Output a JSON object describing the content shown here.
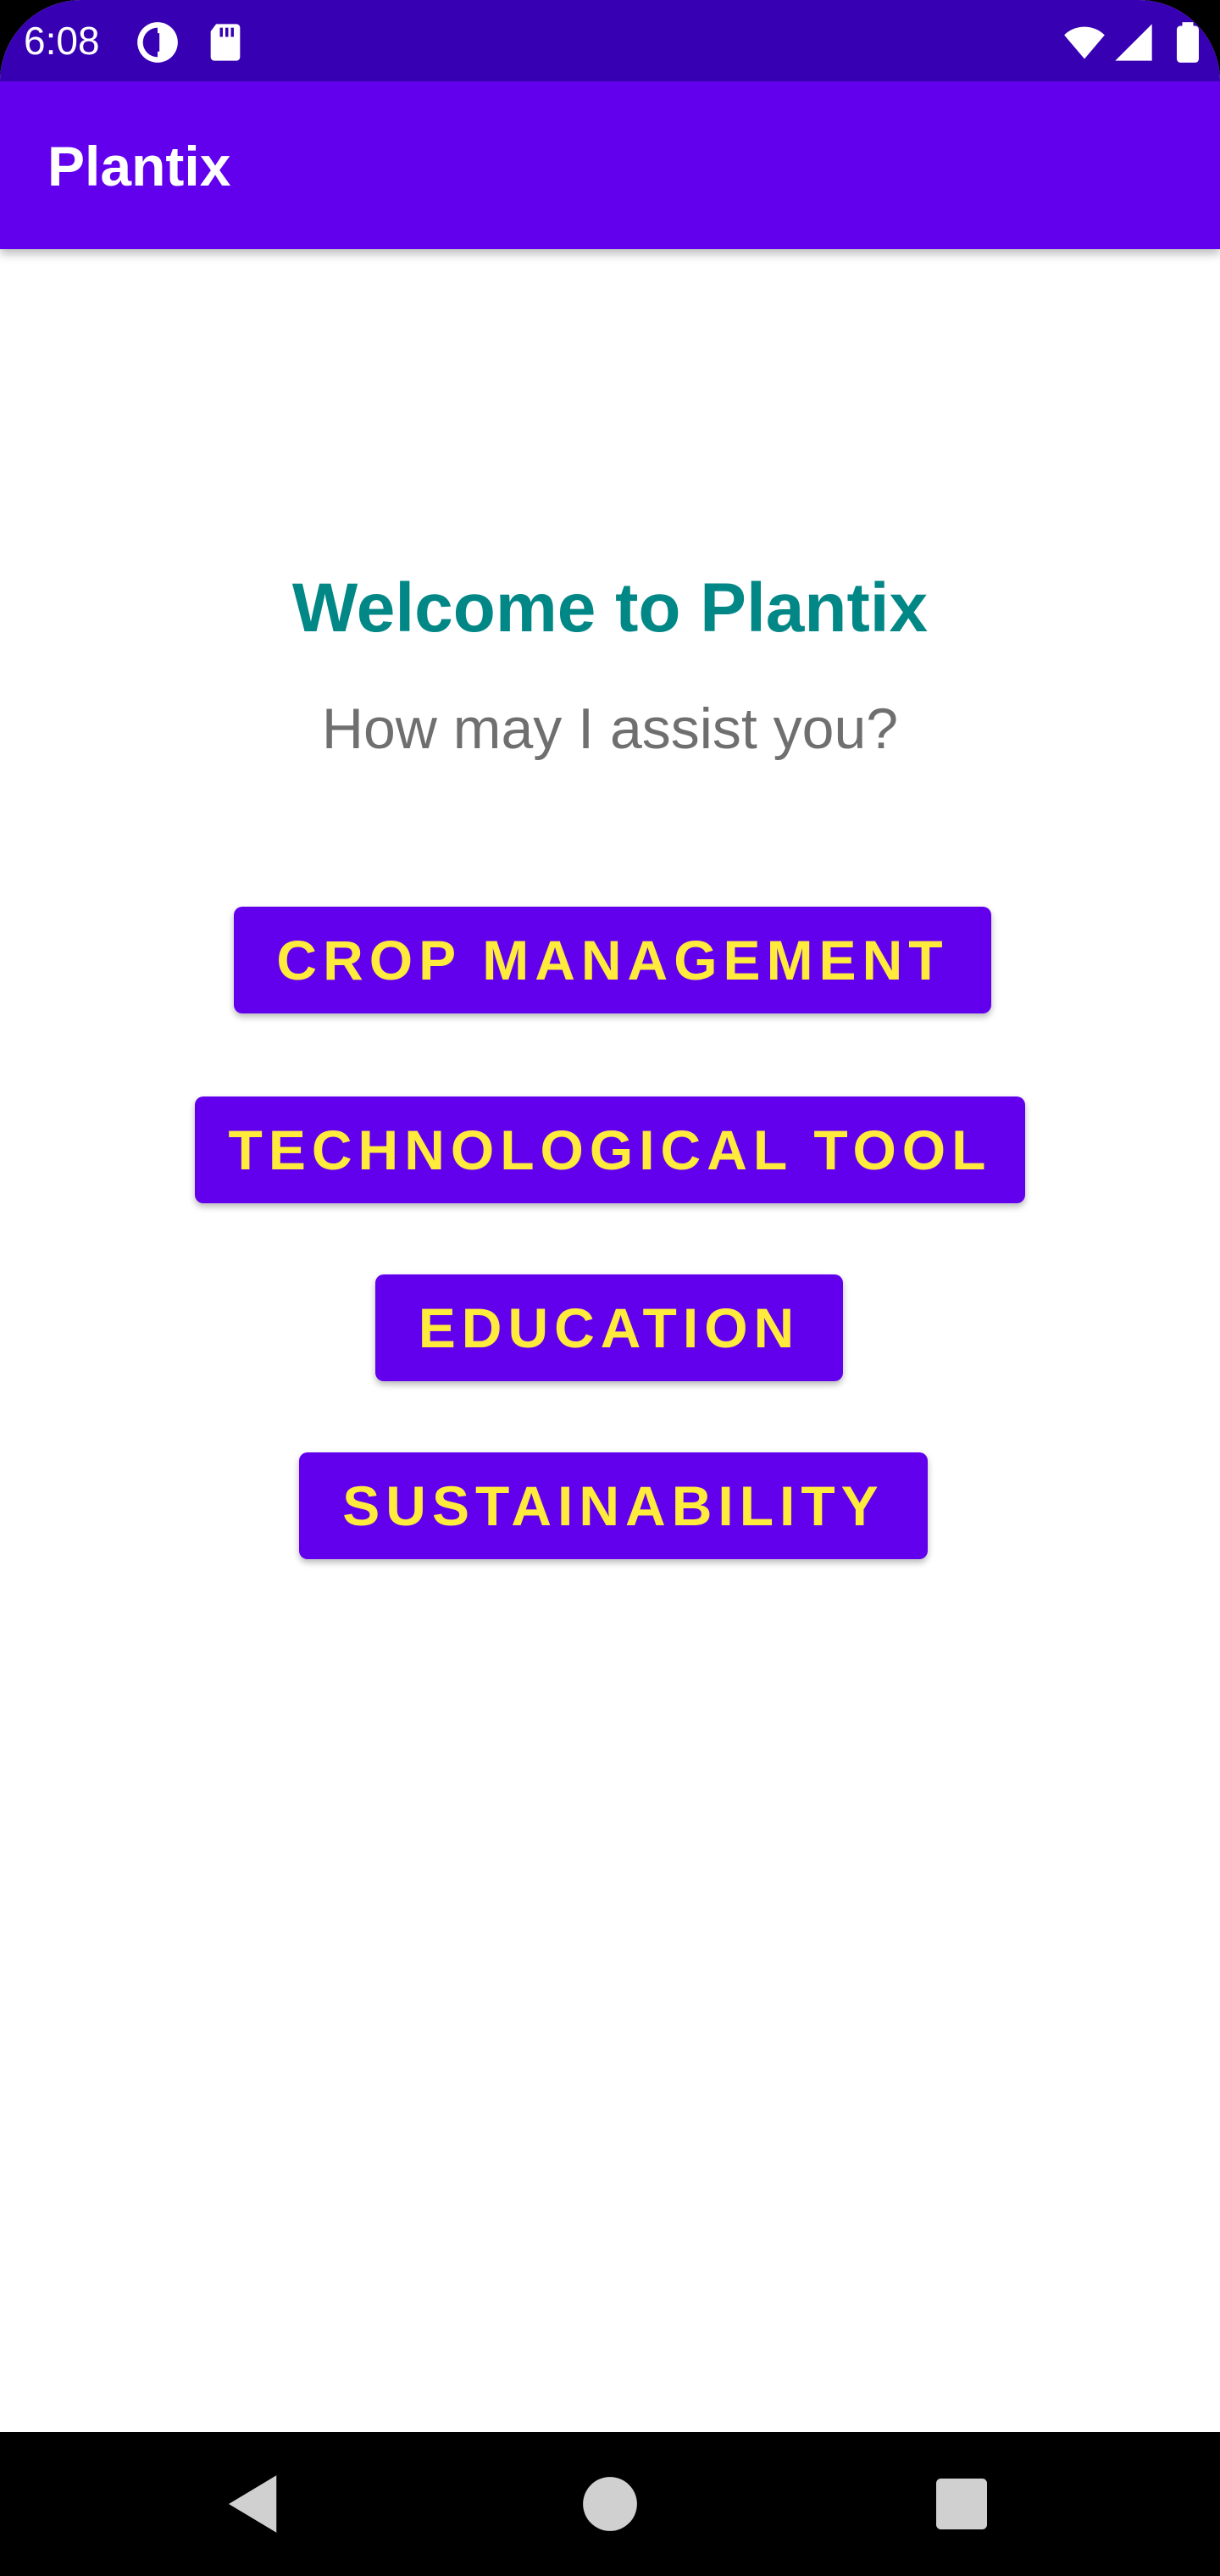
{
  "status_bar": {
    "time": "6:08",
    "icons": [
      "sync-badge-icon",
      "sd-card-icon",
      "wifi-icon",
      "cellular-signal-icon",
      "battery-icon"
    ],
    "background": "#3700b3"
  },
  "app_bar": {
    "title": "Plantix",
    "background": "#6200ee"
  },
  "main": {
    "welcome_title": "Welcome to Plantix",
    "subtitle": "How may I assist you?",
    "title_color": "#018786",
    "buttons": [
      {
        "label": "CROP MANAGEMENT"
      },
      {
        "label": "TECHNOLOGICAL TOOL"
      },
      {
        "label": "EDUCATION"
      },
      {
        "label": "SUSTAINABILITY"
      }
    ],
    "button_background": "#6200ee",
    "button_text_color": "#ffeb3b"
  },
  "nav_bar": {
    "icons": [
      "back-icon",
      "home-icon",
      "recents-icon"
    ]
  }
}
